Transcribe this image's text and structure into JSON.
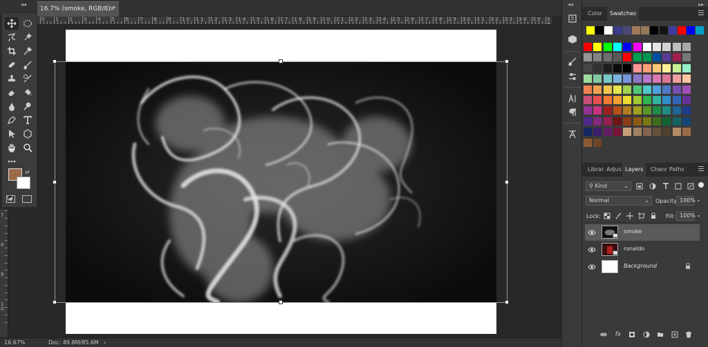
{
  "document": {
    "tab_title": "16.7% (smoke, RGB/8) *",
    "close": "×",
    "collapse_glyph": "◂◂"
  },
  "rulers": {
    "horizontal": [
      "0",
      "1",
      "2",
      "3",
      "4",
      "5",
      "6",
      "7",
      "8",
      "9",
      "1 0",
      "1 1",
      "1 2",
      "1 3",
      "1 4",
      "1 5",
      "1 6",
      "1 7",
      "1 8",
      "1 9",
      "2 0",
      "2 1",
      "2 2",
      "2 3",
      "2 4",
      "2 5",
      "2 6",
      "2 7",
      "2 8",
      "2 9",
      "3 0",
      "3 1",
      "3 2",
      "3 3",
      "3 4",
      "3 5",
      "3 6"
    ],
    "vertical": [
      "7",
      "8",
      "9",
      "1 0"
    ]
  },
  "tools": [
    {
      "name": "move-tool",
      "icon": "move-icon"
    },
    {
      "name": "marquee-tool",
      "icon": "ellipse-marquee-icon"
    },
    {
      "name": "lasso-tool",
      "icon": "lasso-icon"
    },
    {
      "name": "quick-select-tool",
      "icon": "quick-select-icon"
    },
    {
      "name": "crop-tool",
      "icon": "crop-icon"
    },
    {
      "name": "eyedropper-tool",
      "icon": "eyedropper-icon"
    },
    {
      "name": "healing-tool",
      "icon": "bandage-icon"
    },
    {
      "name": "brush-tool",
      "icon": "brush-icon"
    },
    {
      "name": "stamp-tool",
      "icon": "stamp-icon"
    },
    {
      "name": "history-brush-tool",
      "icon": "history-brush-icon"
    },
    {
      "name": "eraser-tool",
      "icon": "eraser-icon"
    },
    {
      "name": "bucket-tool",
      "icon": "paint-bucket-icon"
    },
    {
      "name": "blur-tool",
      "icon": "drop-icon"
    },
    {
      "name": "dodge-tool",
      "icon": "dodge-icon"
    },
    {
      "name": "pen-tool",
      "icon": "pen-icon"
    },
    {
      "name": "type-tool",
      "icon": "type-icon"
    },
    {
      "name": "path-select-tool",
      "icon": "arrow-icon"
    },
    {
      "name": "shape-tool",
      "icon": "hexagon-icon"
    },
    {
      "name": "hand-tool",
      "icon": "hand-icon"
    },
    {
      "name": "zoom-tool",
      "icon": "magnifier-icon"
    },
    {
      "name": "more-tools",
      "icon": "ellipsis-icon"
    }
  ],
  "colors": {
    "foreground": "#9b6c4a",
    "background": "#ffffff"
  },
  "status": {
    "zoom": "16.67%",
    "doc": "Doc: 49.8M/85.6M",
    "arrow": "›"
  },
  "swatches_panel": {
    "tabs": [
      "Color",
      "Swatches"
    ],
    "recent": [
      "#ffff00",
      "#000000",
      "#ffffff",
      "#3c3c8c",
      "#4b4b78",
      "#a0785a",
      "#96785a",
      "#000000",
      "#141414",
      "#3c3ca0",
      "#ff0000",
      "#0000ff",
      "#00a0c8"
    ],
    "rows": [
      [
        "#ff0000",
        "#ffff00",
        "#00ff00",
        "#00ffff",
        "#0000ff",
        "#ff00ff",
        "#ffffff",
        "#e6e6e6",
        "#d2d2d2",
        "#bebebe",
        "#aaaaaa"
      ],
      [
        "#969696",
        "#828282",
        "#6e6e6e",
        "#5a5a5a",
        "#ff0000",
        "#00a050",
        "#009650",
        "#0050a0",
        "#5a3c96",
        "#a01e50",
        "#787878"
      ],
      [
        "#464646",
        "#323232",
        "#1e1e1e",
        "#0a0a0a",
        "#000000",
        "#ff9696",
        "#ffa078",
        "#ffc878",
        "#fff096",
        "#c8f096",
        "#96f0c8"
      ],
      [
        "#a0dca0",
        "#82c8a0",
        "#78c8c8",
        "#78b4dc",
        "#7896dc",
        "#8c78c8",
        "#b478c8",
        "#dc78b4",
        "#dc7896",
        "#f0a0a0",
        "#ffc8a0"
      ],
      [
        "#f08250",
        "#f0a050",
        "#f0c850",
        "#e6e650",
        "#a0d250",
        "#50c878",
        "#50c8c8",
        "#50a0dc",
        "#5078c8",
        "#7850b4",
        "#a050b4"
      ],
      [
        "#c85078",
        "#e65050",
        "#f07832",
        "#f0a032",
        "#f0dc32",
        "#a0c832",
        "#32b450",
        "#32b4a0",
        "#328cc8",
        "#3264b4",
        "#643296"
      ],
      [
        "#963296",
        "#c8327d",
        "#a01e1e",
        "#b4501e",
        "#b47d1e",
        "#a0a01e",
        "#5a9628",
        "#1e8c46",
        "#1e8c82",
        "#1e6496",
        "#1e3c8c"
      ],
      [
        "#50288c",
        "#82287d",
        "#961e50",
        "#6e1414",
        "#8c3c14",
        "#8c5a14",
        "#787814",
        "#3c6e1e",
        "#146432",
        "#146464",
        "#144678"
      ],
      [
        "#142864",
        "#3c1e6e",
        "#641e64",
        "#78143c",
        "#c8a078",
        "#a08264",
        "#826450",
        "#64503c",
        "#50412d",
        "#b48c64",
        "#9b6c4a"
      ],
      [
        "#8c5a32",
        "#6e4628"
      ]
    ]
  },
  "layers_panel": {
    "tabs": [
      "Librar",
      "Adjus",
      "Layers",
      "Chanr",
      "Paths"
    ],
    "filter_label": "Kind",
    "blend_mode": "Normal",
    "opacity_label": "Opacity:",
    "opacity_value": "100%",
    "lock_label": "Lock:",
    "fill_label": "Fill:",
    "fill_value": "100%",
    "layers": [
      {
        "name": "smoke",
        "selected": true,
        "italic": false,
        "thumb": "smoke"
      },
      {
        "name": "ronaldo",
        "selected": false,
        "italic": false,
        "thumb": "ronaldo"
      },
      {
        "name": "Background",
        "selected": false,
        "italic": true,
        "thumb": "white"
      }
    ]
  }
}
